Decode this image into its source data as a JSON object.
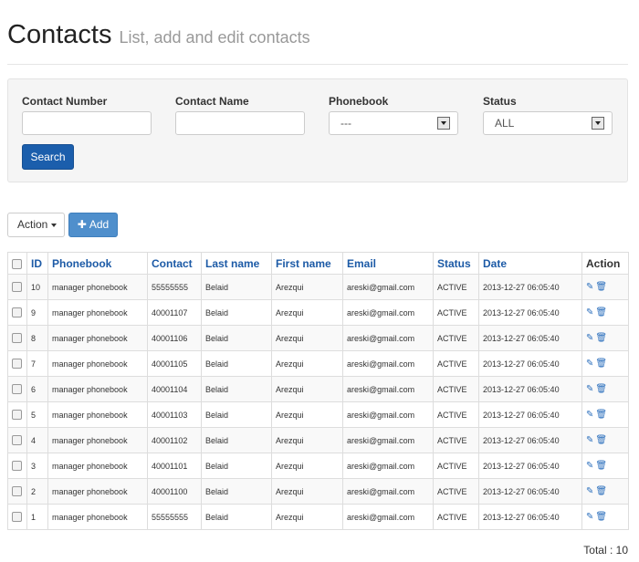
{
  "header": {
    "title": "Contacts",
    "subtitle": "List, add and edit contacts"
  },
  "filters": {
    "contact_number_label": "Contact Number",
    "contact_number_value": "",
    "contact_name_label": "Contact Name",
    "contact_name_value": "",
    "phonebook_label": "Phonebook",
    "phonebook_selected": "---",
    "status_label": "Status",
    "status_selected": "ALL",
    "search_label": "Search"
  },
  "toolbar": {
    "action_label": "Action",
    "add_label": "Add"
  },
  "table": {
    "columns": [
      "ID",
      "Phonebook",
      "Contact",
      "Last name",
      "First name",
      "Email",
      "Status",
      "Date",
      "Action"
    ],
    "rows": [
      {
        "id": "10",
        "phonebook": "manager phonebook",
        "contact": "55555555",
        "last_name": "Belaid",
        "first_name": "Arezqui",
        "email": "areski@gmail.com",
        "status": "ACTIVE",
        "date": "2013-12-27 06:05:40"
      },
      {
        "id": "9",
        "phonebook": "manager phonebook",
        "contact": "40001107",
        "last_name": "Belaid",
        "first_name": "Arezqui",
        "email": "areski@gmail.com",
        "status": "ACTIVE",
        "date": "2013-12-27 06:05:40"
      },
      {
        "id": "8",
        "phonebook": "manager phonebook",
        "contact": "40001106",
        "last_name": "Belaid",
        "first_name": "Arezqui",
        "email": "areski@gmail.com",
        "status": "ACTIVE",
        "date": "2013-12-27 06:05:40"
      },
      {
        "id": "7",
        "phonebook": "manager phonebook",
        "contact": "40001105",
        "last_name": "Belaid",
        "first_name": "Arezqui",
        "email": "areski@gmail.com",
        "status": "ACTIVE",
        "date": "2013-12-27 06:05:40"
      },
      {
        "id": "6",
        "phonebook": "manager phonebook",
        "contact": "40001104",
        "last_name": "Belaid",
        "first_name": "Arezqui",
        "email": "areski@gmail.com",
        "status": "ACTIVE",
        "date": "2013-12-27 06:05:40"
      },
      {
        "id": "5",
        "phonebook": "manager phonebook",
        "contact": "40001103",
        "last_name": "Belaid",
        "first_name": "Arezqui",
        "email": "areski@gmail.com",
        "status": "ACTIVE",
        "date": "2013-12-27 06:05:40"
      },
      {
        "id": "4",
        "phonebook": "manager phonebook",
        "contact": "40001102",
        "last_name": "Belaid",
        "first_name": "Arezqui",
        "email": "areski@gmail.com",
        "status": "ACTIVE",
        "date": "2013-12-27 06:05:40"
      },
      {
        "id": "3",
        "phonebook": "manager phonebook",
        "contact": "40001101",
        "last_name": "Belaid",
        "first_name": "Arezqui",
        "email": "areski@gmail.com",
        "status": "ACTIVE",
        "date": "2013-12-27 06:05:40"
      },
      {
        "id": "2",
        "phonebook": "manager phonebook",
        "contact": "40001100",
        "last_name": "Belaid",
        "first_name": "Arezqui",
        "email": "areski@gmail.com",
        "status": "ACTIVE",
        "date": "2013-12-27 06:05:40"
      },
      {
        "id": "1",
        "phonebook": "manager phonebook",
        "contact": "55555555",
        "last_name": "Belaid",
        "first_name": "Arezqui",
        "email": "areski@gmail.com",
        "status": "ACTIVE",
        "date": "2013-12-27 06:05:40"
      }
    ],
    "row_action_icons": [
      "edit-icon",
      "trash-icon"
    ]
  },
  "footer": {
    "total_text": "Total : 10"
  },
  "colors": {
    "primary": "#1b5eac",
    "add_button": "#4f8fcc",
    "link": "#1c5aa6"
  }
}
